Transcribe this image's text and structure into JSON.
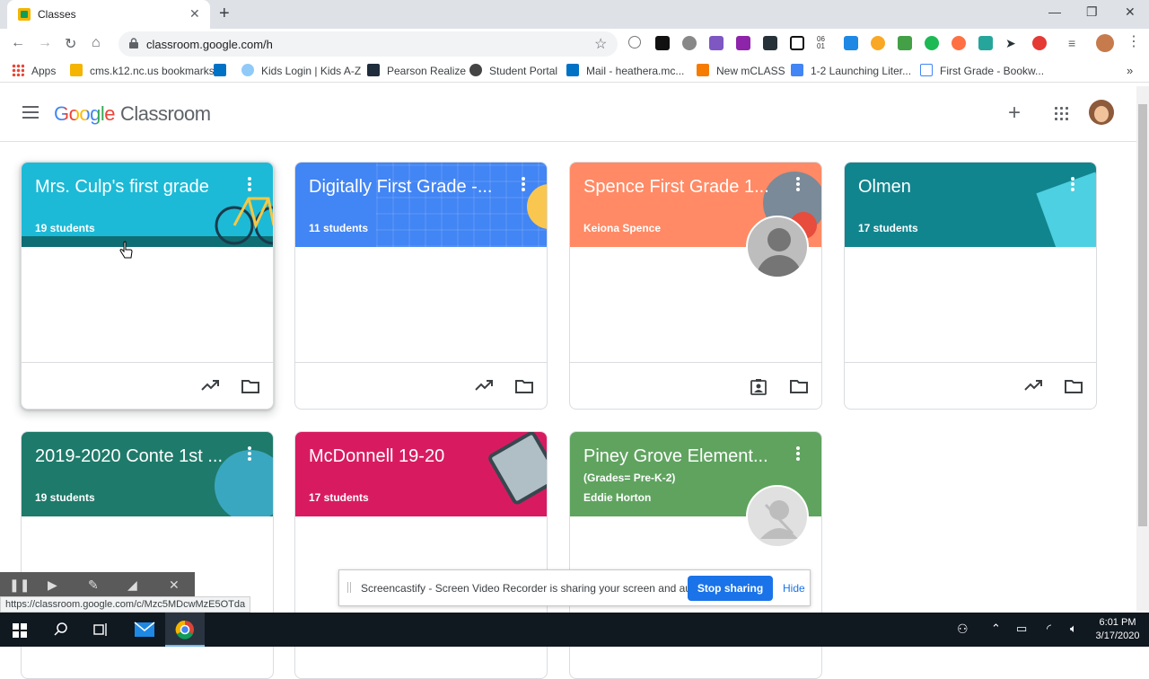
{
  "browser": {
    "tab_title": "Classes",
    "url": "classroom.google.com/h",
    "bookmarks": [
      {
        "label": "Apps",
        "icon": "apps-grid-icon"
      },
      {
        "label": "cms.k12.nc.us bookmarks",
        "icon": "folder-icon"
      },
      {
        "label": "",
        "icon": "outlook-icon"
      },
      {
        "label": "Kids Login | Kids A-Z",
        "icon": "kids-az-icon"
      },
      {
        "label": "Pearson Realize",
        "icon": "pearson-icon"
      },
      {
        "label": "Student Portal",
        "icon": "globe-icon"
      },
      {
        "label": "Mail - heathera.mc...",
        "icon": "outlook-icon"
      },
      {
        "label": "New mCLASS",
        "icon": "amplify-icon"
      },
      {
        "label": "1-2 Launching Liter...",
        "icon": "docs-icon"
      },
      {
        "label": "First Grade - Bookw...",
        "icon": "page-icon"
      }
    ]
  },
  "app": {
    "logo_google": "Google",
    "logo_product": "Classroom"
  },
  "cards": [
    {
      "title": "Mrs. Culp's first grade",
      "subtitle": "19 students",
      "color": "#1cbad6"
    },
    {
      "title": "Digitally First Grade -...",
      "subtitle": "11 students",
      "color": "#4285f4"
    },
    {
      "title": "Spence First Grade 1...",
      "subtitle": "Keiona Spence",
      "color": "#ff8a65"
    },
    {
      "title": "Olmen",
      "subtitle": "17 students",
      "color": "#11858e"
    },
    {
      "title": "2019-2020 Conte 1st ...",
      "subtitle": "19 students",
      "color": "#1e7a6a"
    },
    {
      "title": "McDonnell 19-20",
      "subtitle": "17 students",
      "color": "#d81b60"
    },
    {
      "title": "Piney Grove Element...",
      "section": "(Grades= Pre-K-2)",
      "subtitle": "Eddie Horton",
      "color": "#5fa35f"
    }
  ],
  "screencast": {
    "message": "Screencastify - Screen Video Recorder is sharing your screen and audio.",
    "stop_label": "Stop sharing",
    "hide_label": "Hide"
  },
  "status_url": "https://classroom.google.com/c/Mzc5MDcwMzE5OTda",
  "clock": {
    "time": "6:01 PM",
    "date": "3/17/2020"
  }
}
